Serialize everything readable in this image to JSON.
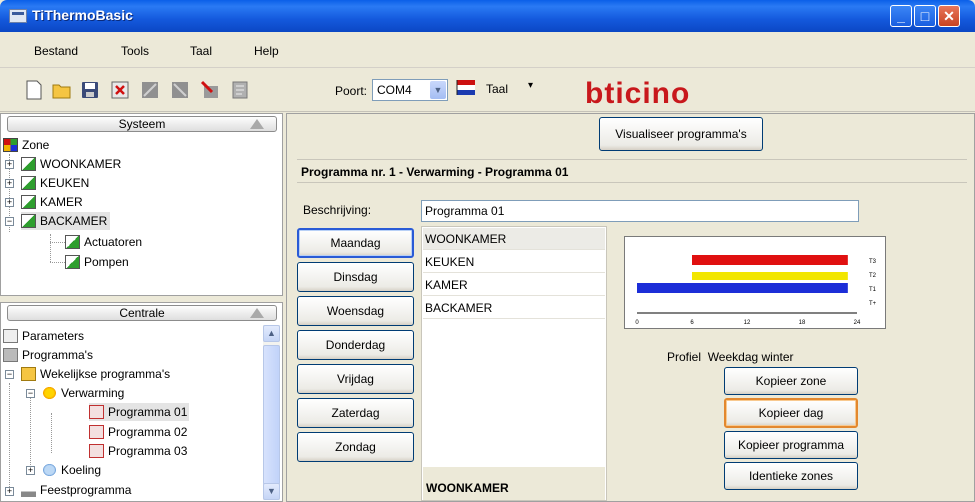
{
  "window": {
    "title": "TiThermoBasic"
  },
  "menu": [
    "Bestand",
    "Tools",
    "Taal",
    "Help"
  ],
  "toolbar": {
    "port_label": "Poort:",
    "port_value": "COM4",
    "lang_label": "Taal",
    "brand": "bticino"
  },
  "systeem": {
    "header": "Systeem",
    "root": "Zone",
    "zones": [
      "WOONKAMER",
      "KEUKEN",
      "KAMER",
      "BACKAMER"
    ],
    "children": [
      "Actuatoren",
      "Pompen"
    ]
  },
  "centrale": {
    "header": "Centrale",
    "items": {
      "parameters": "Parameters",
      "programmas": "Programma's",
      "wekelijks": "Wekelijkse programma's",
      "verwarming": "Verwarming",
      "programs": [
        "Programma 01",
        "Programma 02",
        "Programma 03"
      ],
      "koeling": "Koeling",
      "feest": "Feestprogramma"
    }
  },
  "main": {
    "visualize_button": "Visualiseer programma's",
    "program_header": "Programma nr. 1 - Verwarming - Programma 01",
    "description_label": "Beschrijving:",
    "description_value": "Programma 01",
    "days": [
      "Maandag",
      "Dinsdag",
      "Woensdag",
      "Donderdag",
      "Vrijdag",
      "Zaterdag",
      "Zondag"
    ],
    "zones": [
      "WOONKAMER",
      "KEUKEN",
      "KAMER",
      "BACKAMER"
    ],
    "zone_footer": "WOONKAMER",
    "profile_label": "Profiel",
    "profile_value": "Weekdag winter",
    "buttons": {
      "copy_zone": "Kopieer zone",
      "copy_day": "Kopieer dag",
      "copy_program": "Kopieer programma",
      "identical_zones": "Identieke zones"
    }
  },
  "chart_data": {
    "type": "bar",
    "x_ticks": [
      "0",
      "6",
      "12",
      "18",
      "24"
    ],
    "xlim": [
      0,
      24
    ],
    "levels": [
      "T3",
      "T2",
      "T1",
      "T+"
    ],
    "series": [
      {
        "name": "T3",
        "start": 6,
        "end": 23,
        "color": "#e01010"
      },
      {
        "name": "T2",
        "start": 6,
        "end": 23,
        "color": "#f2e600"
      },
      {
        "name": "T1",
        "start": 0,
        "end": 23,
        "color": "#1c2ed8"
      }
    ]
  },
  "colors": {
    "titlebar": "#0b5ad9",
    "focus_border": "#2a5bd6",
    "hot_border": "#e3882e",
    "brand_red": "#c8181c"
  }
}
